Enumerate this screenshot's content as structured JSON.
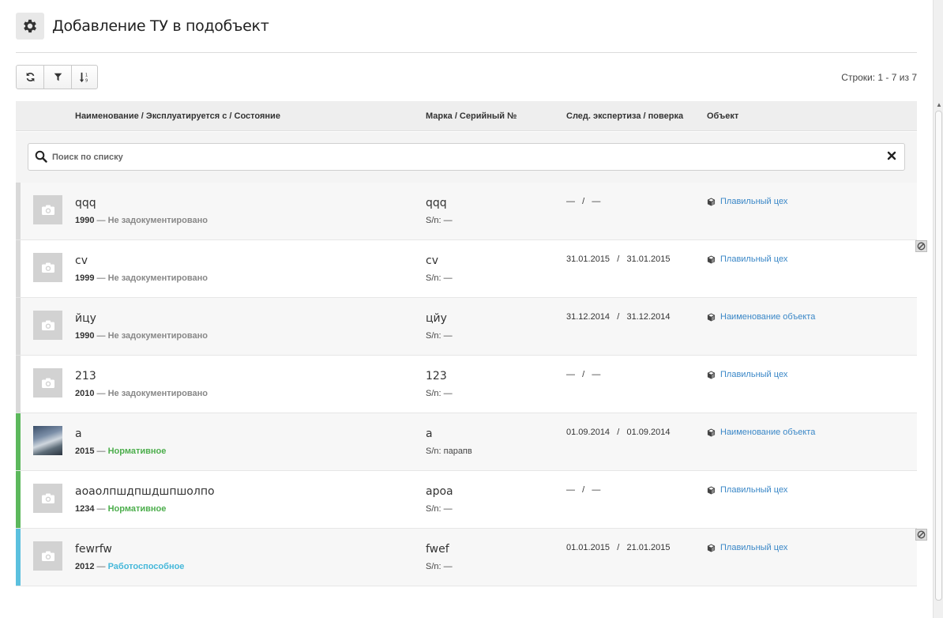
{
  "header": {
    "title": "Добавление ТУ в подобъект",
    "icon": "gear-icon"
  },
  "toolbar": {
    "refresh_icon": "refresh-icon",
    "filter_icon": "filter-icon",
    "sort_icon": "sort-icon"
  },
  "rows_info": "Строки: 1 - 7 из 7",
  "table": {
    "headers": {
      "name": "Наименование / Эксплуатируется с / Состояние",
      "mark": "Марка / Серийный №",
      "expertise": "След. экспертиза / поверка",
      "object": "Объект"
    },
    "search": {
      "placeholder": "Поиск по списку",
      "value": ""
    },
    "rows": [
      {
        "name": "qqq",
        "year": "1990",
        "sep": " — ",
        "state": "Не задокументировано",
        "mark": "qqq",
        "serial": "S/n: —",
        "date1": "—",
        "date2": "—",
        "object": "Плавильный цех"
      },
      {
        "name": "cv",
        "year": "1999",
        "sep": " — ",
        "state": "Не задокументировано",
        "mark": "cv",
        "serial": "S/n: —",
        "date1": "31.01.2015",
        "date2": "31.01.2015",
        "object": "Плавильный цех"
      },
      {
        "name": "йцу",
        "year": "1990",
        "sep": " — ",
        "state": "Не задокументировано",
        "mark": "цйу",
        "serial": "S/n: —",
        "date1": "31.12.2014",
        "date2": "31.12.2014",
        "object": "Наименование объекта"
      },
      {
        "name": "213",
        "year": "2010",
        "sep": " — ",
        "state": "Не задокументировано",
        "mark": "123",
        "serial": "S/n: —",
        "date1": "—",
        "date2": "—",
        "object": "Плавильный цех"
      },
      {
        "name": "a",
        "year": "2015",
        "sep": " — ",
        "state": "Нормативное",
        "mark": "a",
        "serial": "S/n: парапв",
        "date1": "01.09.2014",
        "date2": "01.09.2014",
        "object": "Наименование объекта"
      },
      {
        "name": "аоаолпшдпшдшпшолпо",
        "year": "1234",
        "sep": " — ",
        "state": "Нормативное",
        "mark": "apoa",
        "serial": "S/n: —",
        "date1": "—",
        "date2": "—",
        "object": "Плавильный цех"
      },
      {
        "name": "fewrfw",
        "year": "2012",
        "sep": " — ",
        "state": "Работоспособное",
        "mark": "fwef",
        "serial": "S/n: —",
        "date1": "01.01.2015",
        "date2": "21.01.2015",
        "object": "Плавильный цех"
      }
    ],
    "date_sep": "/"
  },
  "colors": {
    "undocumented": "#d9d9d9",
    "normative": "#5cb85c",
    "operational": "#5bc0de",
    "link": "#3a87c7",
    "state_undocumented_text": "#888888",
    "state_normative_text": "#4cae4c",
    "state_operational_text": "#46b8da"
  }
}
